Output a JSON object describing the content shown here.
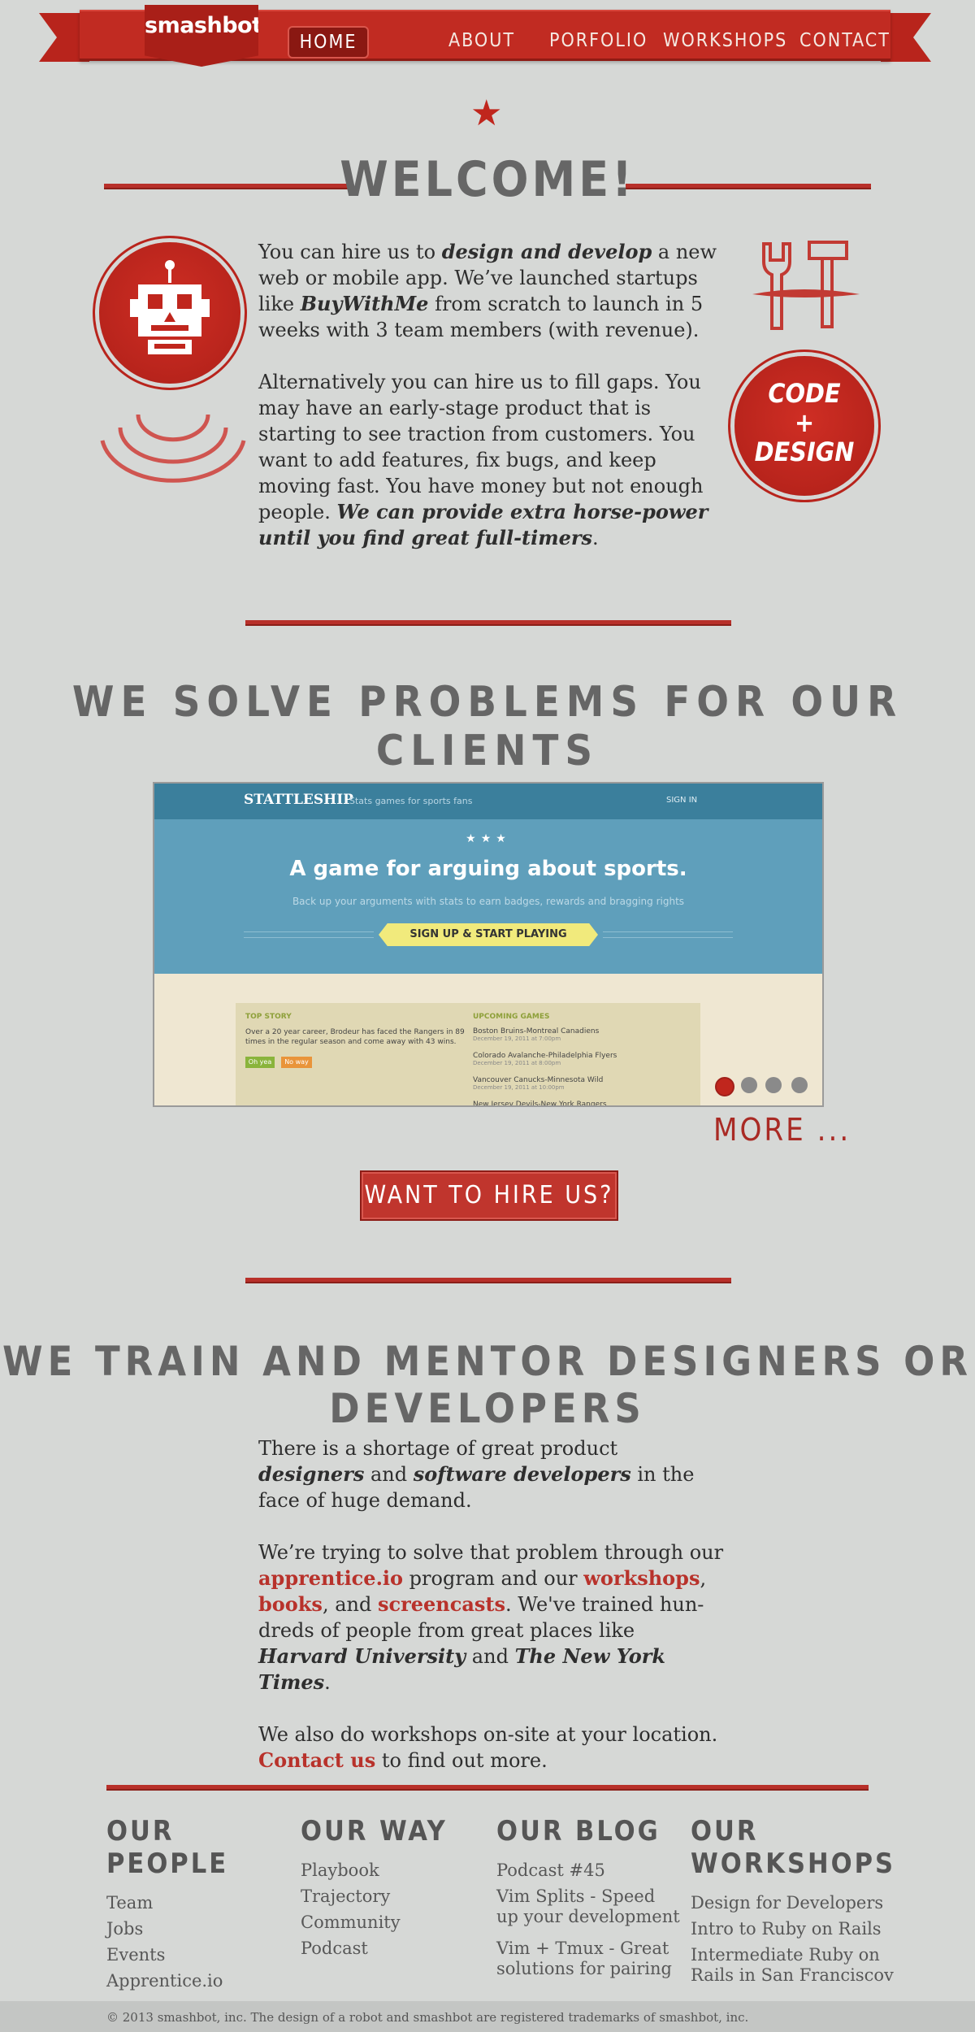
{
  "brand": {
    "name": "smashbot"
  },
  "nav": {
    "items": [
      "Home",
      "About",
      "Porfolio",
      "Workshops",
      "Contact"
    ],
    "active": 0
  },
  "welcome": {
    "heading": "Welcome!",
    "p1": {
      "a": "You can hire us to ",
      "b": "design and develop",
      "c": " a new web or mobile app. We’ve launched startups like ",
      "d": "BuyWithMe",
      "e": " from scratch to launch in 5 weeks with 3 team members (with revenue)."
    },
    "p2": {
      "a": "Alternatively you can hire us to fill gaps. You may have an early-stage product that is starting to see traction from customers. You want to add features, fix bugs, and keep moving fast. You have money but not enough people. ",
      "b": "We can provide extra horse-power until you find great full-timers",
      "c": "."
    },
    "badge": {
      "line1": "Code",
      "line2": "+",
      "line3": "Design"
    }
  },
  "clients": {
    "heading": "We solve problems for our clients",
    "showcase": {
      "brand": "STATTLESHIP",
      "tagline": "Stats games for sports fans",
      "signin": "SIGN IN",
      "headline": "A game for arguing about sports.",
      "subline": "Back up your arguments with stats to earn badges, rewards and bragging rights",
      "cta": "SIGN UP & START PLAYING",
      "top_story_label": "TOP STORY",
      "top_story": "Over a 20 year career, Brodeur has faced the Rangers in 89 times in the regular season and come away with 43 wins.",
      "btn_yes": "Oh yea",
      "btn_no": "No way",
      "upcoming_label": "UPCOMING GAMES",
      "games": [
        {
          "name": "Boston Bruins-Montreal Canadiens",
          "date": "December 19, 2011 at 7:00pm"
        },
        {
          "name": "Colorado Avalanche-Philadelphia Flyers",
          "date": "December 19, 2011 at 8:00pm"
        },
        {
          "name": "Vancouver Canucks-Minnesota Wild",
          "date": "December 19, 2011 at 10:00pm"
        },
        {
          "name": "New Jersey Devils-New York Rangers",
          "date": ""
        }
      ]
    },
    "more": "More ...",
    "hire": "Want to hire us?"
  },
  "train": {
    "heading": "We train and mentor designers or developers",
    "p1": {
      "a": "There is a shortage of great product ",
      "b": "designers",
      "c": " and ",
      "d": "software developers",
      "e": " in the face of huge demand."
    },
    "p2": {
      "a": "We’re trying to solve that problem through our ",
      "l1": "apprentice.io",
      "b": " program and our ",
      "l2": "workshops",
      "c": ", ",
      "l3": "books",
      "d": ", and ",
      "l4": "screencasts",
      "e": ". We've trained hun-dreds of people from great places like ",
      "f": "Harvard University",
      "g": " and ",
      "h": "The New York Times",
      "i": "."
    },
    "p3": {
      "a": "We also do workshops on-site at your location. ",
      "l1": "Contact us",
      "b": " to find out more."
    }
  },
  "footer": {
    "columns": [
      {
        "title": "Our People",
        "links": [
          "Team",
          "Jobs",
          "Events",
          "Apprentice.io"
        ]
      },
      {
        "title": "Our Way",
        "links": [
          "Playbook",
          "Trajectory",
          "Community",
          "Podcast"
        ]
      },
      {
        "title": "Our Blog",
        "links": [
          "Podcast #45",
          "Vim Splits - Speed up your development",
          "Vim + Tmux -  Great solutions for pairing"
        ]
      },
      {
        "title": "Our Workshops",
        "links": [
          "Design for Developers",
          "Intro to Ruby on Rails",
          "Intermediate Ruby on Rails in  San Franciscov"
        ]
      }
    ],
    "copyright": "© 2013 smashbot, inc. The design of a robot and smashbot are registered trademarks of smashbot, inc."
  },
  "colors": {
    "accent": "#c0261d",
    "background": "#d6d8d6",
    "text": "#2e2e2e"
  }
}
